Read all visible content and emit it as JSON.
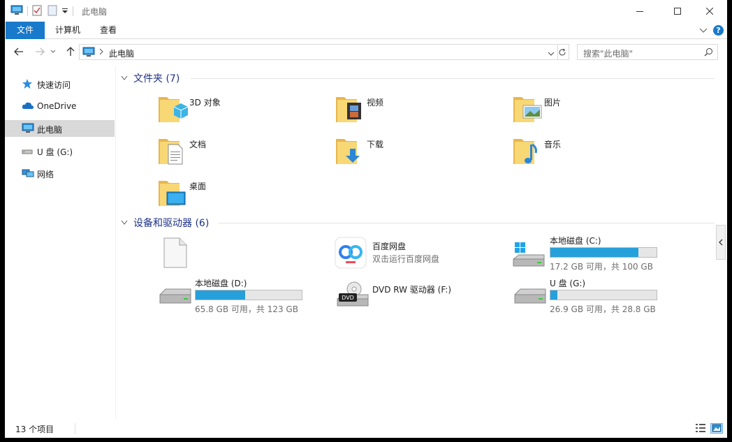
{
  "window": {
    "title": "此电脑"
  },
  "ribbon": {
    "tabs": [
      "文件",
      "计算机",
      "查看"
    ]
  },
  "address": {
    "path": "此电脑",
    "search_placeholder": "搜索\"此电脑\""
  },
  "navpane": {
    "items": [
      {
        "label": "快速访问",
        "icon": "star-icon"
      },
      {
        "label": "OneDrive",
        "icon": "cloud-icon"
      },
      {
        "label": "此电脑",
        "icon": "computer-icon",
        "selected": true
      },
      {
        "label": "U 盘 (G:)",
        "icon": "usb-drive-icon"
      },
      {
        "label": "网络",
        "icon": "network-icon"
      }
    ]
  },
  "folders": {
    "header": "文件夹 (7)",
    "items": [
      {
        "name": "3D 对象",
        "icon": "3d-objects-folder-icon"
      },
      {
        "name": "视频",
        "icon": "videos-folder-icon"
      },
      {
        "name": "图片",
        "icon": "pictures-folder-icon"
      },
      {
        "name": "文档",
        "icon": "documents-folder-icon"
      },
      {
        "name": "下载",
        "icon": "downloads-folder-icon"
      },
      {
        "name": "音乐",
        "icon": "music-folder-icon"
      },
      {
        "name": "桌面",
        "icon": "desktop-folder-icon"
      }
    ]
  },
  "drives": {
    "header": "设备和驱动器 (6)",
    "items": [
      {
        "name": "",
        "icon": "blank-file-icon"
      },
      {
        "name": "百度网盘",
        "sub": "双击运行百度网盘",
        "icon": "baidu-netdisk-icon"
      },
      {
        "name": "本地磁盘 (C:)",
        "sub": "17.2 GB 可用，共 100 GB",
        "used_fraction": 0.828,
        "icon": "windows-drive-icon"
      },
      {
        "name": "本地磁盘 (D:)",
        "sub": "65.8 GB 可用，共 123 GB",
        "used_fraction": 0.465,
        "icon": "hard-drive-icon"
      },
      {
        "name": "DVD RW 驱动器 (F:)",
        "icon": "dvd-drive-icon",
        "badge": "DVD"
      },
      {
        "name": "U 盘 (G:)",
        "sub": "26.9 GB 可用，共 28.8 GB",
        "used_fraction": 0.066,
        "icon": "usb-drive-icon"
      }
    ]
  },
  "status": {
    "count": "13 个项目"
  },
  "colors": {
    "accent": "#1979ca",
    "bar_fill": "#26a0da",
    "group_title": "#1e3287",
    "folder": "#f8d775"
  }
}
